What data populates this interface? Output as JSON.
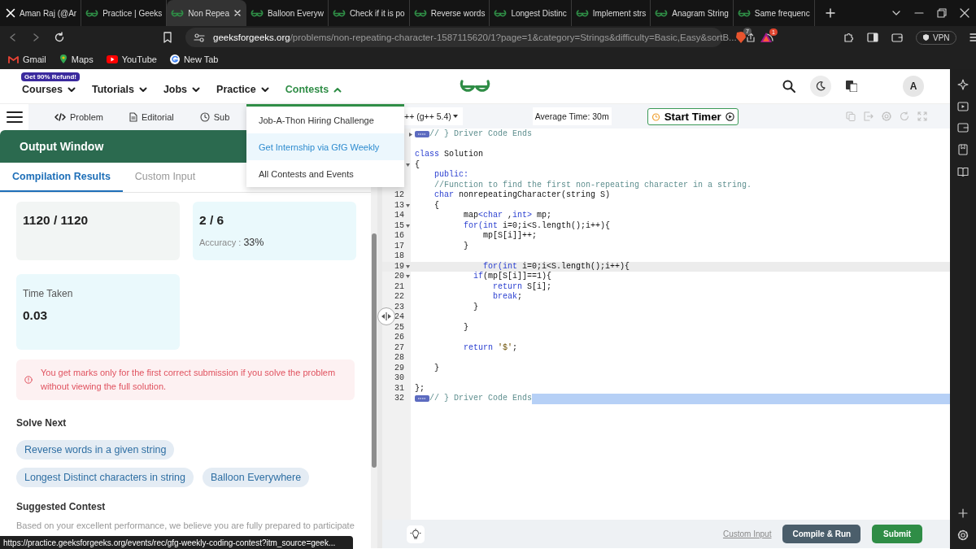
{
  "browser": {
    "tabs": [
      {
        "title": "Aman Raj (@Ar",
        "selected": false
      },
      {
        "title": "Practice | Geeks",
        "selected": false
      },
      {
        "title": "Non Repea",
        "selected": true
      },
      {
        "title": "Balloon Everyw",
        "selected": false
      },
      {
        "title": "Check if it is po",
        "selected": false
      },
      {
        "title": "Reverse words",
        "selected": false
      },
      {
        "title": "Longest Distinc",
        "selected": false
      },
      {
        "title": "Implement strs",
        "selected": false
      },
      {
        "title": "Anagram String",
        "selected": false
      },
      {
        "title": "Same frequenc",
        "selected": false
      }
    ],
    "url": {
      "host": "geeksforgeeks.org",
      "path": "/problems/non-repeating-character-1587115620/1?page=1&category=Strings&difficulty=Basic,Easy&sortB..."
    },
    "shield_count": "7",
    "rewards_count": "1",
    "vpn": "VPN",
    "bookmarks": [
      "Gmail",
      "Maps",
      "YouTube",
      "New Tab"
    ]
  },
  "header": {
    "promo": "Get 90% Refund!",
    "nav": [
      {
        "label": "Courses",
        "selected": false,
        "expanded": false
      },
      {
        "label": "Tutorials",
        "selected": false,
        "expanded": false
      },
      {
        "label": "Jobs",
        "selected": false,
        "expanded": false
      },
      {
        "label": "Practice",
        "selected": false,
        "expanded": false
      },
      {
        "label": "Contests",
        "selected": true,
        "expanded": true
      }
    ],
    "avatar": "A"
  },
  "contest_menu": [
    {
      "label": "Job-A-Thon Hiring Challenge",
      "highlighted": false
    },
    {
      "label": "Get Internship via GfG Weekly",
      "highlighted": true
    },
    {
      "label": "All Contests and Events",
      "highlighted": false
    }
  ],
  "problem_tabs": [
    "Problem",
    "Editorial",
    "Sub"
  ],
  "output": {
    "title": "Output Window",
    "tabs": [
      {
        "label": "Compilation Results",
        "selected": true
      },
      {
        "label": "Custom Input",
        "selected": false
      }
    ],
    "cards": [
      {
        "value": "1120 / 1120",
        "color": "#f2f5f4"
      },
      {
        "value": "2 / 6",
        "note_label": "Accuracy : ",
        "note_value": "33%",
        "color": "#eaf9fc"
      },
      {
        "label": "Time Taken",
        "value": "0.03",
        "color": "#eaf9fc"
      }
    ],
    "notice": "You get marks only for the first correct submission if you solve the problem without viewing the full solution.",
    "solve_next_title": "Solve Next",
    "solve_next": [
      "Reverse words in a given string",
      "Longest Distinct characters in string",
      "Balloon Everywhere"
    ],
    "contest_title": "Suggested Contest",
    "contest_text": "Based on your excellent performance, we believe you are fully prepared to participate"
  },
  "editor": {
    "language": "++ (g++ 5.4)",
    "average_time": "Average Time: 30m",
    "timer_button": "Start Timer",
    "lines": [
      {
        "foldable": true,
        "collapsed": true,
        "active": false,
        "selection": false,
        "code": [
          {
            "kind": "marker"
          },
          {
            "kind": "comment",
            "text": "// } Driver Code Ends"
          }
        ]
      },
      {
        "foldable": false,
        "collapsed": false,
        "active": false,
        "selection": false
      },
      {
        "foldable": false,
        "collapsed": false,
        "active": false,
        "selection": false,
        "code": [
          {
            "kind": "keyword",
            "text": "class"
          },
          {
            "kind": "plain",
            "text": " Solution"
          }
        ]
      },
      {
        "foldable": true,
        "collapsed": false,
        "active": false,
        "selection": false,
        "code": [
          {
            "kind": "plain",
            "text": "{"
          }
        ]
      },
      {
        "foldable": false,
        "collapsed": false,
        "active": false,
        "selection": false,
        "code": [
          {
            "kind": "keyword",
            "text": "    public:"
          }
        ]
      },
      {
        "foldable": false,
        "collapsed": false,
        "active": false,
        "selection": false,
        "code": [
          {
            "kind": "comment",
            "text": "    //Function to find the first non-repeating character in a string."
          }
        ]
      },
      {
        "number": "12",
        "foldable": false,
        "collapsed": false,
        "active": false,
        "selection": false,
        "code": [
          {
            "kind": "keyword",
            "text": "    char"
          },
          {
            "kind": "plain",
            "text": " nonrepeatingCharacter(string S)"
          }
        ]
      },
      {
        "number": "13",
        "foldable": true,
        "collapsed": false,
        "active": false,
        "selection": false,
        "code": [
          {
            "kind": "plain",
            "text": "    {"
          }
        ]
      },
      {
        "number": "14",
        "foldable": false,
        "collapsed": false,
        "active": false,
        "selection": false,
        "code": [
          {
            "kind": "plain",
            "text": "          map"
          },
          {
            "kind": "keyword",
            "text": "<char"
          },
          {
            "kind": "plain",
            "text": " ,"
          },
          {
            "kind": "keyword",
            "text": "int>"
          },
          {
            "kind": "plain",
            "text": " mp;"
          }
        ]
      },
      {
        "number": "15",
        "foldable": true,
        "collapsed": false,
        "active": false,
        "selection": false,
        "code": [
          {
            "kind": "keyword",
            "text": "          for(int"
          },
          {
            "kind": "plain",
            "text": " i=0;i<S.length();i++){"
          }
        ]
      },
      {
        "number": "16",
        "foldable": false,
        "collapsed": false,
        "active": false,
        "selection": false,
        "code": [
          {
            "kind": "plain",
            "text": "              mp[S[i]]++;"
          }
        ]
      },
      {
        "number": "17",
        "foldable": false,
        "collapsed": false,
        "active": false,
        "selection": false,
        "code": [
          {
            "kind": "plain",
            "text": "          }"
          }
        ]
      },
      {
        "number": "18",
        "foldable": false,
        "collapsed": false,
        "active": false,
        "selection": false
      },
      {
        "number": "19",
        "foldable": true,
        "collapsed": false,
        "active": true,
        "selection": false,
        "code": [
          {
            "kind": "keyword",
            "text": "              for(int"
          },
          {
            "kind": "plain",
            "text": " i=0;i<S.length();i++){"
          }
        ]
      },
      {
        "number": "20",
        "foldable": true,
        "collapsed": false,
        "active": false,
        "selection": false,
        "code": [
          {
            "kind": "keyword",
            "text": "            if"
          },
          {
            "kind": "plain",
            "text": "(mp[S[i]]==1){"
          }
        ]
      },
      {
        "number": "21",
        "foldable": false,
        "collapsed": false,
        "active": false,
        "selection": false,
        "code": [
          {
            "kind": "keyword",
            "text": "                return"
          },
          {
            "kind": "plain",
            "text": " S[i];"
          }
        ]
      },
      {
        "number": "22",
        "foldable": false,
        "collapsed": false,
        "active": false,
        "selection": false,
        "code": [
          {
            "kind": "keyword",
            "text": "                break"
          },
          {
            "kind": "plain",
            "text": ";"
          }
        ]
      },
      {
        "number": "23",
        "foldable": false,
        "collapsed": false,
        "active": false,
        "selection": false,
        "code": [
          {
            "kind": "plain",
            "text": "            }"
          }
        ]
      },
      {
        "number": "24",
        "foldable": false,
        "collapsed": false,
        "active": false,
        "selection": false
      },
      {
        "number": "25",
        "foldable": false,
        "collapsed": false,
        "active": false,
        "selection": false,
        "code": [
          {
            "kind": "plain",
            "text": "          }"
          }
        ]
      },
      {
        "number": "26",
        "foldable": false,
        "collapsed": false,
        "active": false,
        "selection": false
      },
      {
        "number": "27",
        "foldable": false,
        "collapsed": false,
        "active": false,
        "selection": false,
        "code": [
          {
            "kind": "keyword",
            "text": "          return"
          },
          {
            "kind": "string",
            "text": " '$'"
          },
          {
            "kind": "plain",
            "text": ";"
          }
        ]
      },
      {
        "number": "28",
        "foldable": false,
        "collapsed": false,
        "active": false,
        "selection": false
      },
      {
        "number": "29",
        "foldable": false,
        "collapsed": false,
        "active": false,
        "selection": false,
        "code": [
          {
            "kind": "plain",
            "text": "    }"
          }
        ]
      },
      {
        "number": "30",
        "foldable": false,
        "collapsed": false,
        "active": false,
        "selection": false
      },
      {
        "number": "31",
        "foldable": false,
        "collapsed": false,
        "active": false,
        "selection": false,
        "code": [
          {
            "kind": "plain",
            "text": "};"
          }
        ]
      },
      {
        "number": "32",
        "foldable": false,
        "collapsed": false,
        "active": false,
        "selection": true,
        "code": [
          {
            "kind": "marker"
          },
          {
            "kind": "comment",
            "text": "// } Driver Code Ends"
          }
        ]
      }
    ],
    "custom_input": "Custom Input",
    "compile_button": "Compile & Run",
    "submit_button": "Submit"
  },
  "status_url": "https://practice.geeksforgeeks.org/events/rec/gfg-weekly-coding-contest?itm_source=geek..."
}
